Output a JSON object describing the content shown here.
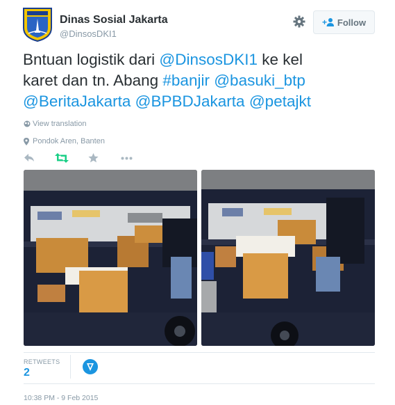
{
  "user": {
    "display_name": "Dinas Sosial Jakarta",
    "screen_name": "@DinsosDKI1",
    "avatar_label": "JAYA RAYA"
  },
  "header": {
    "follow_label": "Follow"
  },
  "tweet": {
    "line1_prefix": "Bntuan logistik dari ",
    "mention_dinsos": "@DinsosDKI1",
    "line1_suffix": " ke kel",
    "line2_prefix": "karet dan tn. Abang ",
    "hashtag_banjir": "#banjir",
    "mention_basuki": "@basuki_btp",
    "mention_berita": "@BeritaJakarta",
    "mention_bpbd": "@BPBDJakarta",
    "mention_peta": "@petajkt"
  },
  "translate_label": "View translation",
  "location_label": "Pondok Aren, Banten",
  "stats": {
    "retweets_label": "RETWEETS",
    "retweets_count": "2"
  },
  "timestamp": "10:38 PM - 9 Feb 2015",
  "colors": {
    "link": "#1b95e0",
    "retweet_active": "#19cf86",
    "muted": "#8899a6"
  },
  "icons": [
    "gear-icon",
    "add-user-icon",
    "globe-icon",
    "location-pin-icon",
    "reply-icon",
    "retweet-icon",
    "favorite-icon",
    "more-icon",
    "verified-icon"
  ]
}
